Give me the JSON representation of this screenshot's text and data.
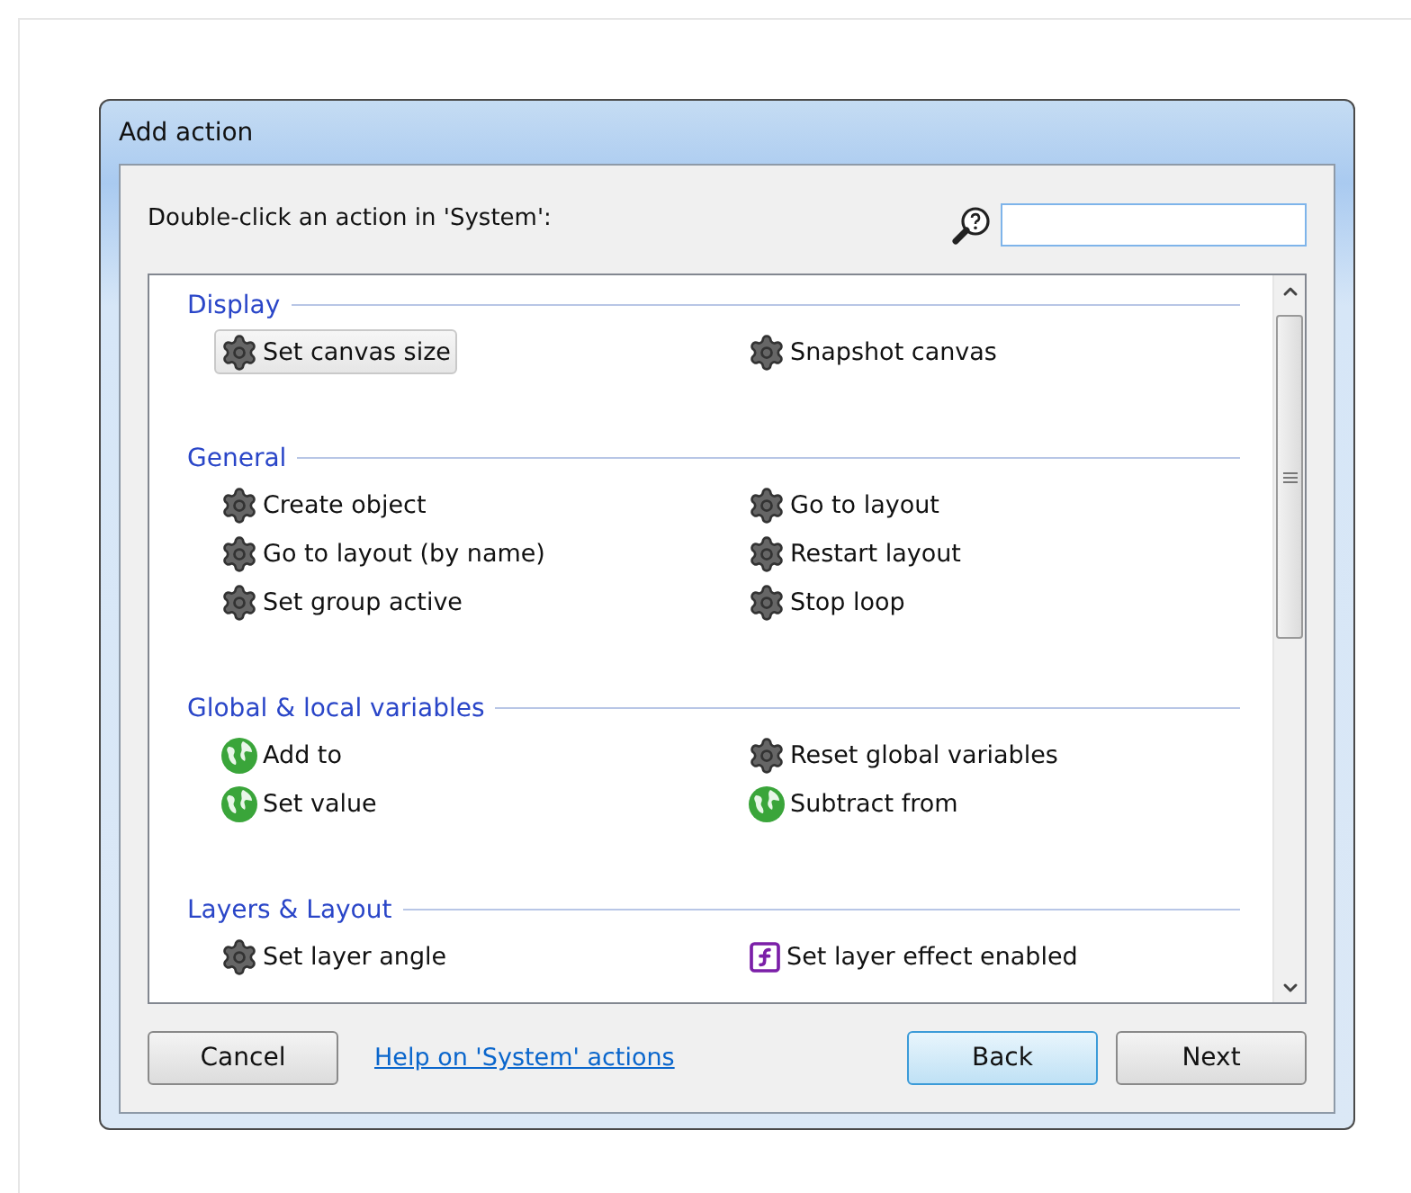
{
  "window": {
    "title": "Add action"
  },
  "prompt": "Double-click an action in 'System':",
  "sections": [
    {
      "title": "Display",
      "items": [
        {
          "label": "Set canvas size",
          "kind": "gear",
          "selected": true
        },
        {
          "label": "Snapshot canvas",
          "kind": "gear",
          "selected": false
        }
      ]
    },
    {
      "title": "General",
      "items": [
        {
          "label": "Create object",
          "kind": "gear",
          "selected": false
        },
        {
          "label": "Go to layout",
          "kind": "gear",
          "selected": false
        },
        {
          "label": "Go to layout (by name)",
          "kind": "gear",
          "selected": false
        },
        {
          "label": "Restart layout",
          "kind": "gear",
          "selected": false
        },
        {
          "label": "Set group active",
          "kind": "gear",
          "selected": false
        },
        {
          "label": "Stop loop",
          "kind": "gear",
          "selected": false
        }
      ]
    },
    {
      "title": "Global & local variables",
      "items": [
        {
          "label": "Add to",
          "kind": "globe",
          "selected": false
        },
        {
          "label": "Reset global variables",
          "kind": "gear",
          "selected": false
        },
        {
          "label": "Set value",
          "kind": "globe",
          "selected": false
        },
        {
          "label": "Subtract from",
          "kind": "globe",
          "selected": false
        }
      ]
    },
    {
      "title": "Layers & Layout",
      "items": [
        {
          "label": "Set layer angle",
          "kind": "gear",
          "selected": false
        },
        {
          "label": "Set layer effect enabled",
          "kind": "fx",
          "selected": false
        }
      ]
    }
  ],
  "buttons": {
    "cancel": "Cancel",
    "help_link": "Help on 'System' actions",
    "back": "Back",
    "next": "Next"
  }
}
